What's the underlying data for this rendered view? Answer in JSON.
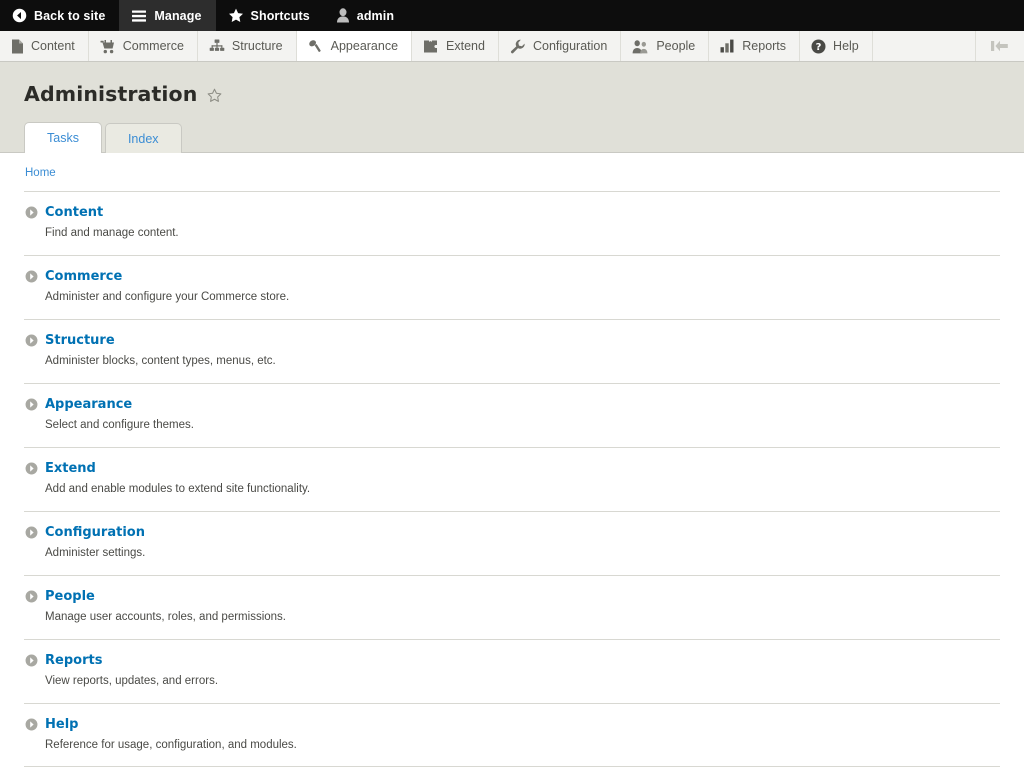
{
  "toolbar": {
    "items": [
      {
        "label": "Back to site",
        "icon": "back-arrow-circle-icon",
        "active": false
      },
      {
        "label": "Manage",
        "icon": "hamburger-icon",
        "active": true
      },
      {
        "label": "Shortcuts",
        "icon": "star-icon",
        "active": false
      },
      {
        "label": "admin",
        "icon": "user-icon",
        "active": false
      }
    ]
  },
  "admin_menu": {
    "items": [
      {
        "label": "Content",
        "icon": "document-icon",
        "highlighted": false
      },
      {
        "label": "Commerce",
        "icon": "shopping-cart-icon",
        "highlighted": false
      },
      {
        "label": "Structure",
        "icon": "sitemap-icon",
        "highlighted": false
      },
      {
        "label": "Appearance",
        "icon": "paint-roller-icon",
        "highlighted": true
      },
      {
        "label": "Extend",
        "icon": "puzzle-piece-icon",
        "highlighted": false
      },
      {
        "label": "Configuration",
        "icon": "wrench-icon",
        "highlighted": false
      },
      {
        "label": "People",
        "icon": "people-icon",
        "highlighted": false
      },
      {
        "label": "Reports",
        "icon": "bar-chart-icon",
        "highlighted": false
      },
      {
        "label": "Help",
        "icon": "question-circle-icon",
        "highlighted": false
      }
    ],
    "orientation_toggle": "vertical-orientation-toggle-icon"
  },
  "header": {
    "title": "Administration",
    "shortcut_star": "star-outline-icon"
  },
  "tabs": [
    {
      "label": "Tasks",
      "active": true
    },
    {
      "label": "Index",
      "active": false
    }
  ],
  "breadcrumb": {
    "home": "Home"
  },
  "panels": [
    {
      "title": "Content",
      "description": "Find and manage content."
    },
    {
      "title": "Commerce",
      "description": "Administer and configure your Commerce store."
    },
    {
      "title": "Structure",
      "description": "Administer blocks, content types, menus, etc."
    },
    {
      "title": "Appearance",
      "description": "Select and configure themes."
    },
    {
      "title": "Extend",
      "description": "Add and enable modules to extend site functionality."
    },
    {
      "title": "Configuration",
      "description": "Administer settings."
    },
    {
      "title": "People",
      "description": "Manage user accounts, roles, and permissions."
    },
    {
      "title": "Reports",
      "description": "View reports, updates, and errors."
    },
    {
      "title": "Help",
      "description": "Reference for usage, configuration, and modules."
    }
  ],
  "colors": {
    "toolbar_bg": "#0d0d0d",
    "toolbar_active": "#2d2d2d",
    "admin_bar_bg": "#f3f3f1",
    "header_bg": "#e0e0d8",
    "link_blue": "#0071b3",
    "tab_blue": "#3b8dd4",
    "divider": "#d8d8d2"
  }
}
